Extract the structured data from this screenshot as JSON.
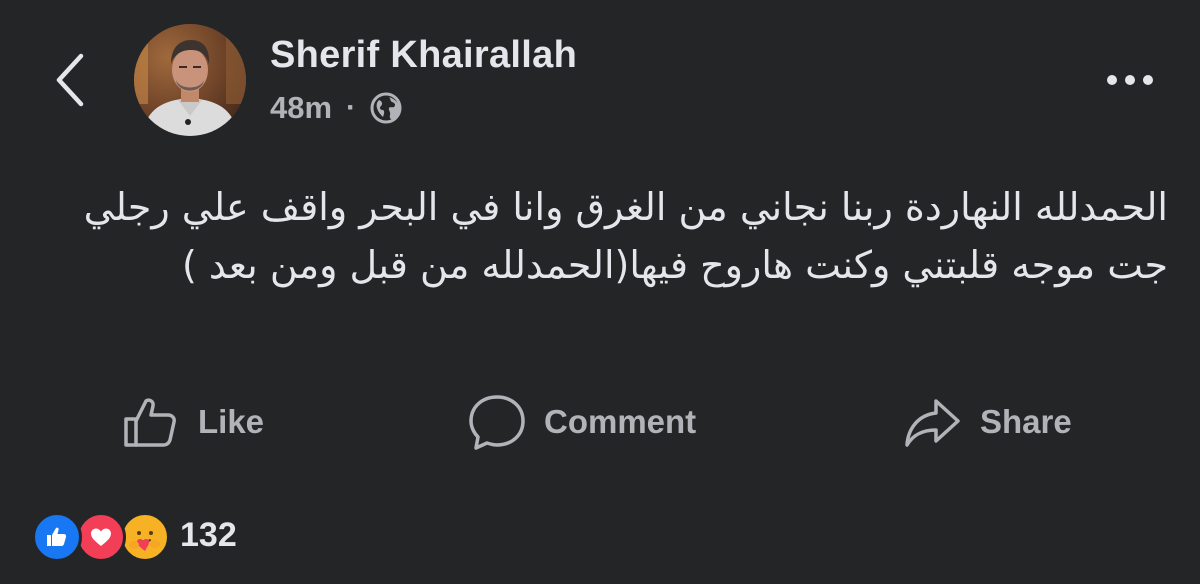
{
  "header": {
    "back_icon": "chevron-left-icon",
    "author_name": "Sherif Khairallah",
    "timestamp": "48m",
    "separator": "·",
    "audience_icon": "globe-icon",
    "more_icon": "more-horizontal-icon"
  },
  "post": {
    "text": "الحمدلله النهاردة ربنا نجاني من الغرق وانا في البحر واقف علي رجلي جت موجه قلبتني وكنت  هاروح فيها(الحمدلله من قبل ومن بعد )"
  },
  "actions": {
    "like_label": "Like",
    "comment_label": "Comment",
    "share_label": "Share"
  },
  "reactions": {
    "types": [
      "like",
      "love",
      "care"
    ],
    "count": "132"
  },
  "colors": {
    "background": "#242526",
    "primary_text": "#e4e6eb",
    "secondary_text": "#b0b3b8",
    "like_blue": "#1877f2",
    "love_red": "#f33e58",
    "care_yellow": "#f7b125"
  }
}
